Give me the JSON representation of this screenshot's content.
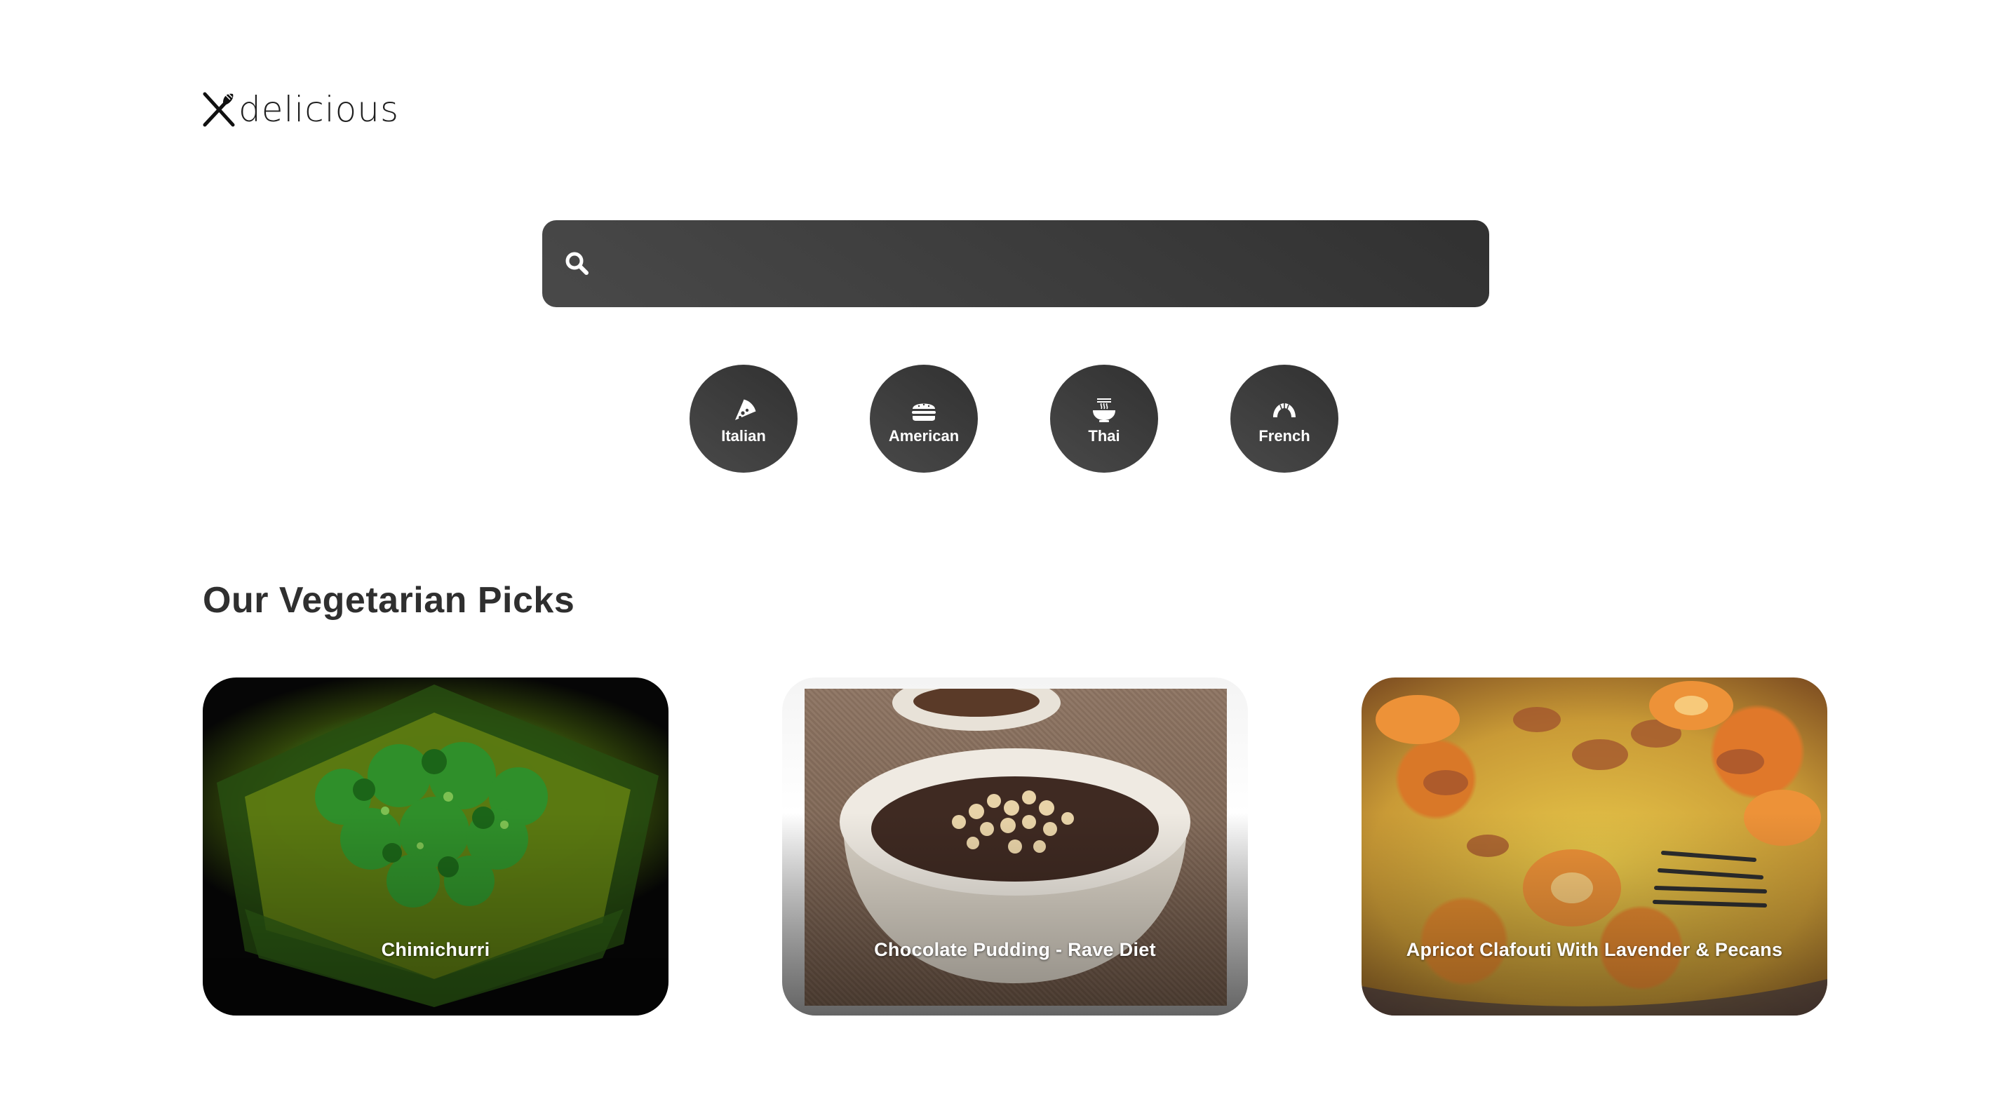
{
  "brand": {
    "logo_text": "delicious",
    "logo_icon": "fork-knife-icon"
  },
  "search": {
    "value": "",
    "placeholder": "",
    "icon": "search-icon"
  },
  "cuisines": [
    {
      "label": "Italian",
      "icon": "pizza-icon"
    },
    {
      "label": "American",
      "icon": "hamburger-icon"
    },
    {
      "label": "Thai",
      "icon": "noodle-bowl-icon"
    },
    {
      "label": "French",
      "icon": "croissant-icon"
    }
  ],
  "section": {
    "title": "Our Vegetarian Picks"
  },
  "recipes": [
    {
      "title": "Chimichurri"
    },
    {
      "title": "Chocolate Pudding - Rave Diet"
    },
    {
      "title": "Apricot Clafouti With Lavender & Pecans"
    }
  ],
  "colors": {
    "button_gradient_start": "#494949",
    "button_gradient_end": "#313131",
    "text": "#313131",
    "background": "#ffffff"
  }
}
